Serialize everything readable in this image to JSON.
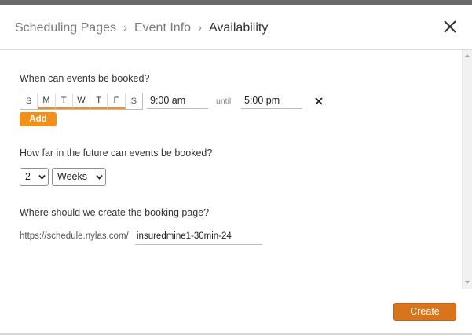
{
  "breadcrumb": {
    "items": [
      "Scheduling Pages",
      "Event Info",
      "Availability"
    ],
    "separator": "›"
  },
  "availability": {
    "question": "When can events be booked?",
    "days": [
      {
        "label": "S",
        "selected": false
      },
      {
        "label": "M",
        "selected": true
      },
      {
        "label": "T",
        "selected": true
      },
      {
        "label": "W",
        "selected": true
      },
      {
        "label": "T",
        "selected": true
      },
      {
        "label": "F",
        "selected": true
      },
      {
        "label": "S",
        "selected": false
      }
    ],
    "start_time": "9:00 am",
    "until_label": "until",
    "end_time": "5:00 pm",
    "add_label": "Add"
  },
  "future": {
    "question": "How far in the future can events be booked?",
    "amount": "2",
    "unit": "Weeks"
  },
  "booking_page": {
    "question": "Where should we create the booking page?",
    "url_prefix": "https://schedule.nylas.com/",
    "slug": "insuredmine1-30min-24"
  },
  "footer": {
    "create_label": "Create"
  },
  "colors": {
    "accent": "#f39019",
    "create_button": "#d8741c"
  }
}
